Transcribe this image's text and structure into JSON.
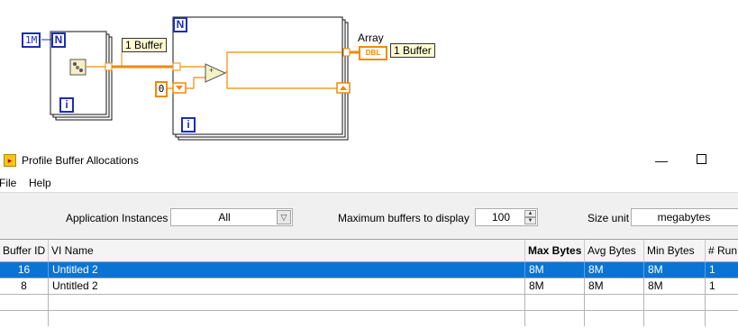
{
  "diagram": {
    "numeric_constant": "1M",
    "count_terminal": "N",
    "iteration_terminal": "i",
    "buffer_label_left": "1 Buffer",
    "buffer_label_right": "1 Buffer",
    "array_indicator_label": "Array",
    "array_type": "DBL",
    "zero_constant": "0",
    "add_symbol": "+"
  },
  "window": {
    "title": "Profile Buffer Allocations",
    "minimize_glyph": "—"
  },
  "menu": [
    "File",
    "Help"
  ],
  "settings": {
    "application_instances_label": "Application Instances",
    "application_instances_value": "All",
    "max_buffers_label": "Maximum buffers to display",
    "max_buffers_value": "100",
    "size_unit_label": "Size unit",
    "size_unit_value": "megabytes"
  },
  "table": {
    "columns": [
      "Buffer ID",
      "VI Name",
      "Max Bytes",
      "Avg Bytes",
      "Min Bytes",
      "# Run"
    ],
    "rows": [
      {
        "id": "16",
        "vi": "Untitled 2",
        "max": "8M",
        "avg": "8M",
        "min": "8M",
        "runs": "1",
        "selected": true
      },
      {
        "id": "8",
        "vi": "Untitled 2",
        "max": "8M",
        "avg": "8M",
        "min": "8M",
        "runs": "1",
        "selected": false
      }
    ]
  },
  "colors": {
    "wire_orange": "#f08a00",
    "terminal_blue": "#1a2fb4",
    "selection_blue": "#0a74d4"
  }
}
